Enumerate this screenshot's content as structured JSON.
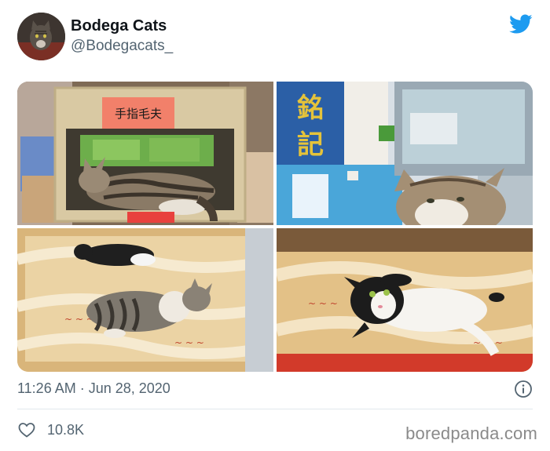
{
  "author": {
    "display_name": "Bodega Cats",
    "handle": "@Bodegacats_",
    "avatar_icon": "cat-avatar"
  },
  "brand": {
    "logo_icon": "twitter-bird-icon",
    "accent": "#1d9bf0"
  },
  "media": {
    "photos": [
      {
        "subject": "tabby cat sleeping in basket",
        "sign_text": "手指毛夫"
      },
      {
        "subject": "tabby cat peeking by shop counter",
        "sign_text": "銘記"
      },
      {
        "subject": "two cats lying on bags of dried goods"
      },
      {
        "subject": "black and white cat lying on its back on bags"
      }
    ]
  },
  "meta": {
    "timestamp": "11:26 AM · Jun 28, 2020",
    "info_icon": "info-icon"
  },
  "stats": {
    "likes": "10.8K",
    "like_icon": "heart-icon"
  },
  "watermark": "boredpanda.com",
  "colors": {
    "text_primary": "#0f1419",
    "text_secondary": "#536471",
    "divider": "#e1e8ed"
  }
}
